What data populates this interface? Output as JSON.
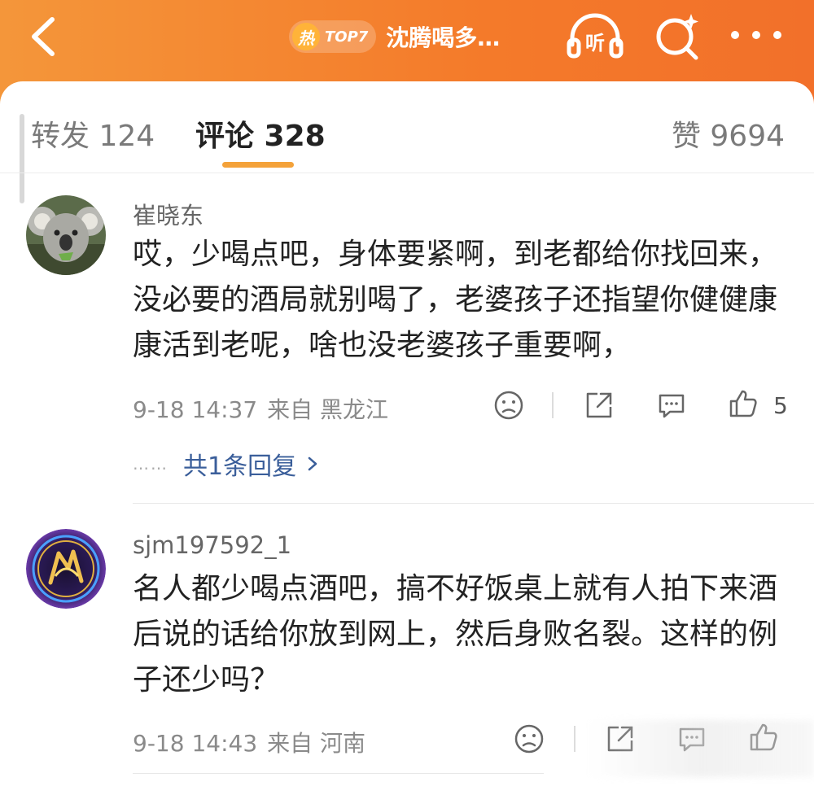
{
  "header": {
    "hot_badge_char": "热",
    "hot_rank": "TOP7",
    "topic_title": "沈腾喝多…",
    "listen_label": "听",
    "icons": {
      "back": "back-chevron-icon",
      "listen": "headphones-icon",
      "search": "sparkle-search-icon",
      "more": "more-dots-icon"
    }
  },
  "tabs": {
    "repost": "转发 124",
    "comment": "评论 328",
    "like": "赞 9694",
    "active": "comment",
    "accent": "#f4a23a"
  },
  "comments": [
    {
      "username": "崔晓东",
      "avatar": "koala-avatar",
      "content": "哎，少喝点吧，身体要紧啊，到老都给你找回来，没必要的酒局就别喝了，老婆孩子还指望你健健康康活到老呢，啥也没老婆孩子重要啊，",
      "date_time": "9-18 14:37",
      "location": "来自 黑龙江",
      "like_count": "5",
      "replies_label": "共1条回复",
      "replies_dots": "……"
    },
    {
      "username": "sjm197592_1",
      "avatar": "dragon-emblem-avatar",
      "content": "名人都少喝点酒吧，搞不好饭桌上就有人拍下来酒后说的话给你放到网上，然后身败名裂。这样的例子还少吗？",
      "date_time": "9-18 14:43",
      "location": "来自 河南",
      "like_count": ""
    }
  ],
  "colors": {
    "header_start": "#f4963a",
    "header_end": "#f2702a",
    "link": "#3a5e9a"
  }
}
